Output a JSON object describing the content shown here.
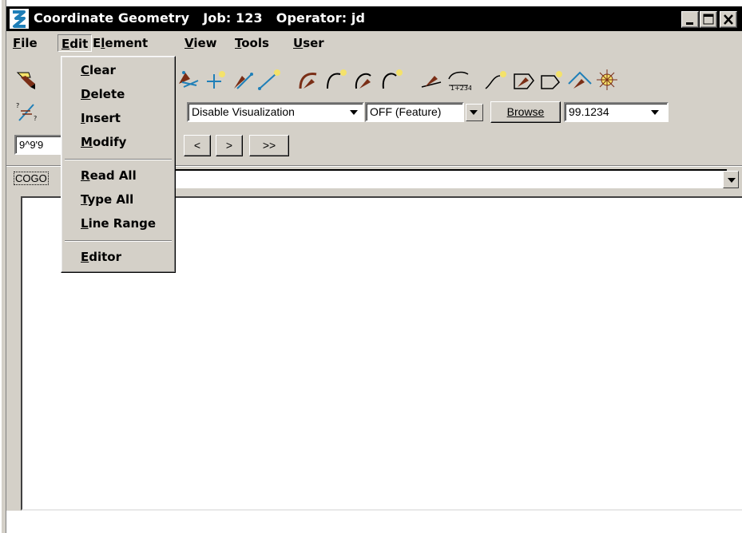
{
  "window": {
    "title": "Coordinate Geometry   Job: 123   Operator: jd"
  },
  "menubar": {
    "items": [
      {
        "label": "File",
        "underline": "F"
      },
      {
        "label": "Edit",
        "underline": "E",
        "open": true
      },
      {
        "label": "Element",
        "underline": "l"
      },
      {
        "label": "View",
        "underline": "V"
      },
      {
        "label": "Tools",
        "underline": "T"
      },
      {
        "label": "User",
        "underline": "U"
      }
    ]
  },
  "edit_menu": {
    "groups": [
      [
        "Clear",
        "Delete",
        "Insert",
        "Modify"
      ],
      [
        "Read All",
        "Type All",
        "Line Range"
      ],
      [
        "Editor"
      ]
    ]
  },
  "toolbar": {
    "visualization_select": "Disable Visualization",
    "feature_select": "OFF (Feature)",
    "browse_label": "Browse",
    "precision_select": "99.1234",
    "angle_field": "9^9'9",
    "nav_buttons": [
      "<",
      ">",
      ">>"
    ],
    "icon_label_1234": "1+234"
  },
  "command": {
    "label": "COGO",
    "value": ""
  },
  "colors": {
    "titlebar": "#000000",
    "face": "#d4d0c8",
    "icon_yellow": "#f4e26a",
    "icon_brown": "#7a2e16",
    "icon_blue": "#1f7fb8"
  },
  "icons": [
    "app-icon",
    "pencil-point-icon",
    "store-point-icon",
    "point-plus-icon",
    "hammer-line-icon",
    "line-icon",
    "hammer-curve-icon",
    "arc-icon",
    "hammer-spiral-icon",
    "spiral-icon",
    "hammer-arc-icon",
    "alignment-icon",
    "curve-star-icon",
    "hammer-parcel-icon",
    "parcel-icon",
    "hammer-triangle-icon",
    "sparkle-icon",
    "pen-equal-icon"
  ]
}
